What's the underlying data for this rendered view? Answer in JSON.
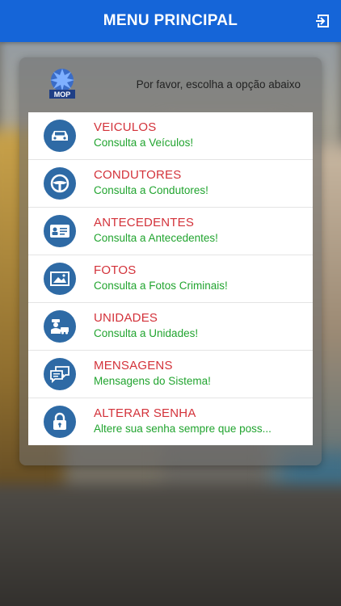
{
  "header": {
    "title": "MENU PRINCIPAL",
    "logout_icon": "logout-icon"
  },
  "panel": {
    "logo_text": "MOP",
    "prompt": "Por favor, escolha a opção abaixo"
  },
  "menu": {
    "items": [
      {
        "title": "VEICULOS",
        "subtitle": "Consulta a Veículos!",
        "icon": "car-icon"
      },
      {
        "title": "CONDUTORES",
        "subtitle": "Consulta a Condutores!",
        "icon": "steering-wheel-icon"
      },
      {
        "title": "ANTECEDENTES",
        "subtitle": "Consulta a Antecedentes!",
        "icon": "id-card-icon"
      },
      {
        "title": "FOTOS",
        "subtitle": "Consulta a Fotos Criminais!",
        "icon": "photo-icon"
      },
      {
        "title": "UNIDADES",
        "subtitle": "Consulta a Unidades!",
        "icon": "police-unit-icon"
      },
      {
        "title": "MENSAGENS",
        "subtitle": "Mensagens do Sistema!",
        "icon": "chat-icon"
      },
      {
        "title": "ALTERAR SENHA",
        "subtitle": "Altere sua senha sempre que poss...",
        "icon": "lock-icon"
      }
    ]
  },
  "colors": {
    "header": "#1565d8",
    "icon_circle": "#2e6aa5",
    "title_red": "#d3323a",
    "subtitle_green": "#21a42f"
  }
}
